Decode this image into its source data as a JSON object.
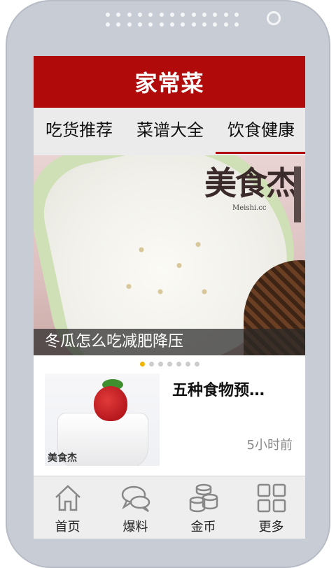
{
  "app": {
    "title": "家常菜"
  },
  "tabs": [
    {
      "label": "吃货推荐"
    },
    {
      "label": "菜谱大全"
    },
    {
      "label": "饮食健康"
    }
  ],
  "banner": {
    "caption": "冬瓜怎么吃减肥降压",
    "watermark": "美食杰",
    "watermark_url": "Meishi.cc",
    "page_index": 1,
    "page_count": 7
  },
  "feed": [
    {
      "title": "五种食物预…",
      "time": "5小时前",
      "thumb_mark": "美食杰"
    }
  ],
  "bottom_nav": [
    {
      "label": "首页",
      "icon": "home-icon"
    },
    {
      "label": "爆料",
      "icon": "chat-bubbles-icon"
    },
    {
      "label": "金币",
      "icon": "coins-icon"
    },
    {
      "label": "更多",
      "icon": "grid-icon"
    }
  ],
  "colors": {
    "brand_red": "#b00a0a",
    "active_dot": "#f0b400"
  }
}
